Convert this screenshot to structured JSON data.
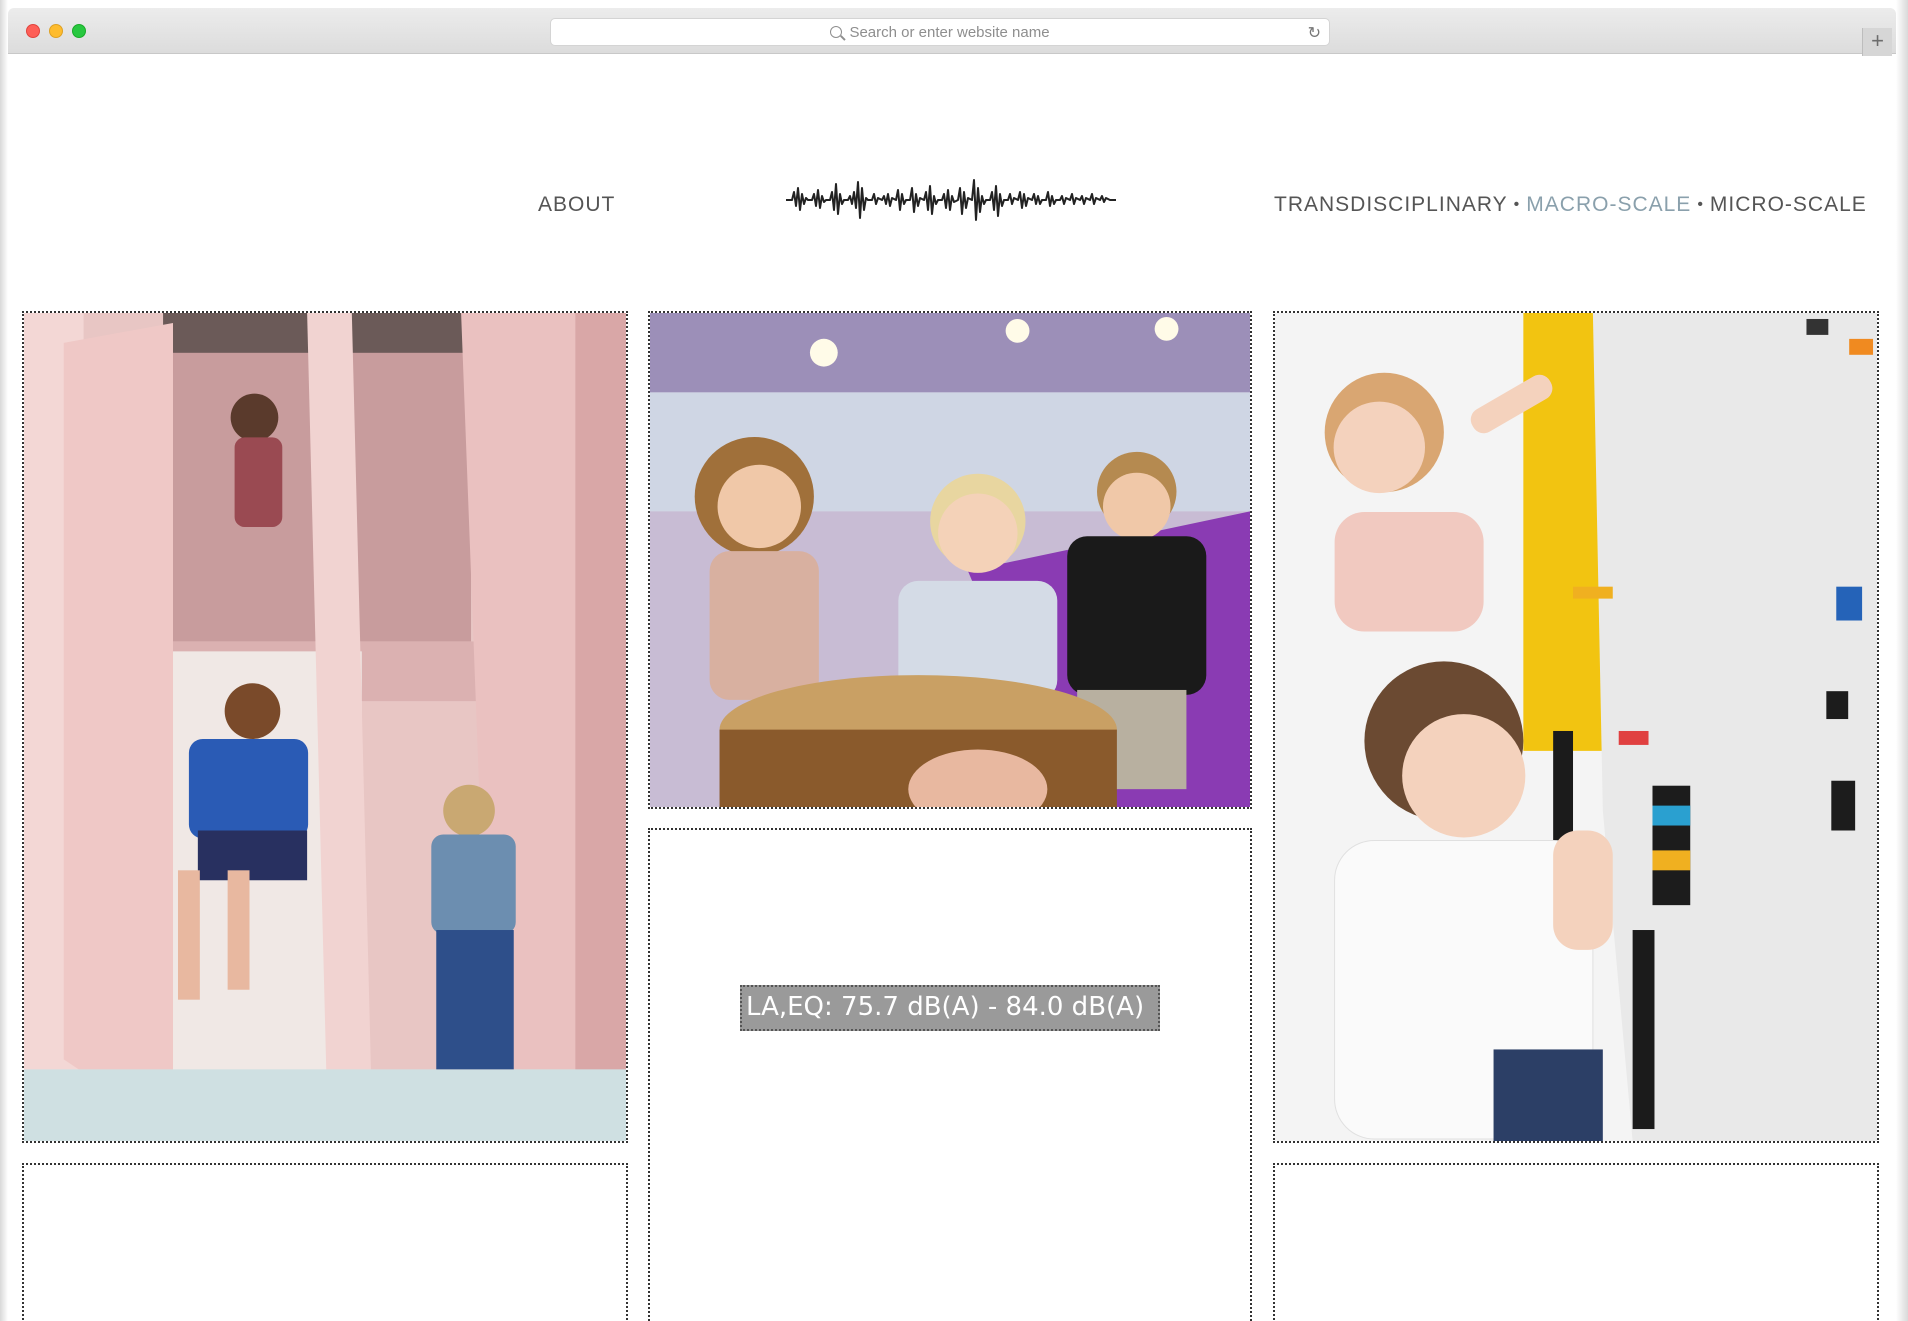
{
  "browser": {
    "address_placeholder": "Search or enter website name",
    "new_tab_label": "+"
  },
  "nav": {
    "about": "ABOUT",
    "transdisciplinary": "TRANSDISCIPLINARY",
    "separator": "•",
    "macro_scale": "MACRO-SCALE",
    "micro_scale": "MICRO-SCALE",
    "active_color": "#8aa0ac"
  },
  "logo": {
    "icon": "sound-waveform-icon"
  },
  "cards": {
    "top_left_image": "children-on-pink-terrazzo-slide-photo",
    "top_center_image": "toddlers-playing-drum-photo",
    "top_right_image": "children-building-on-lego-wall-photo",
    "center_measurement": "LA,EQ: 75.7 dB(A) - 84.0 dB(A)"
  }
}
